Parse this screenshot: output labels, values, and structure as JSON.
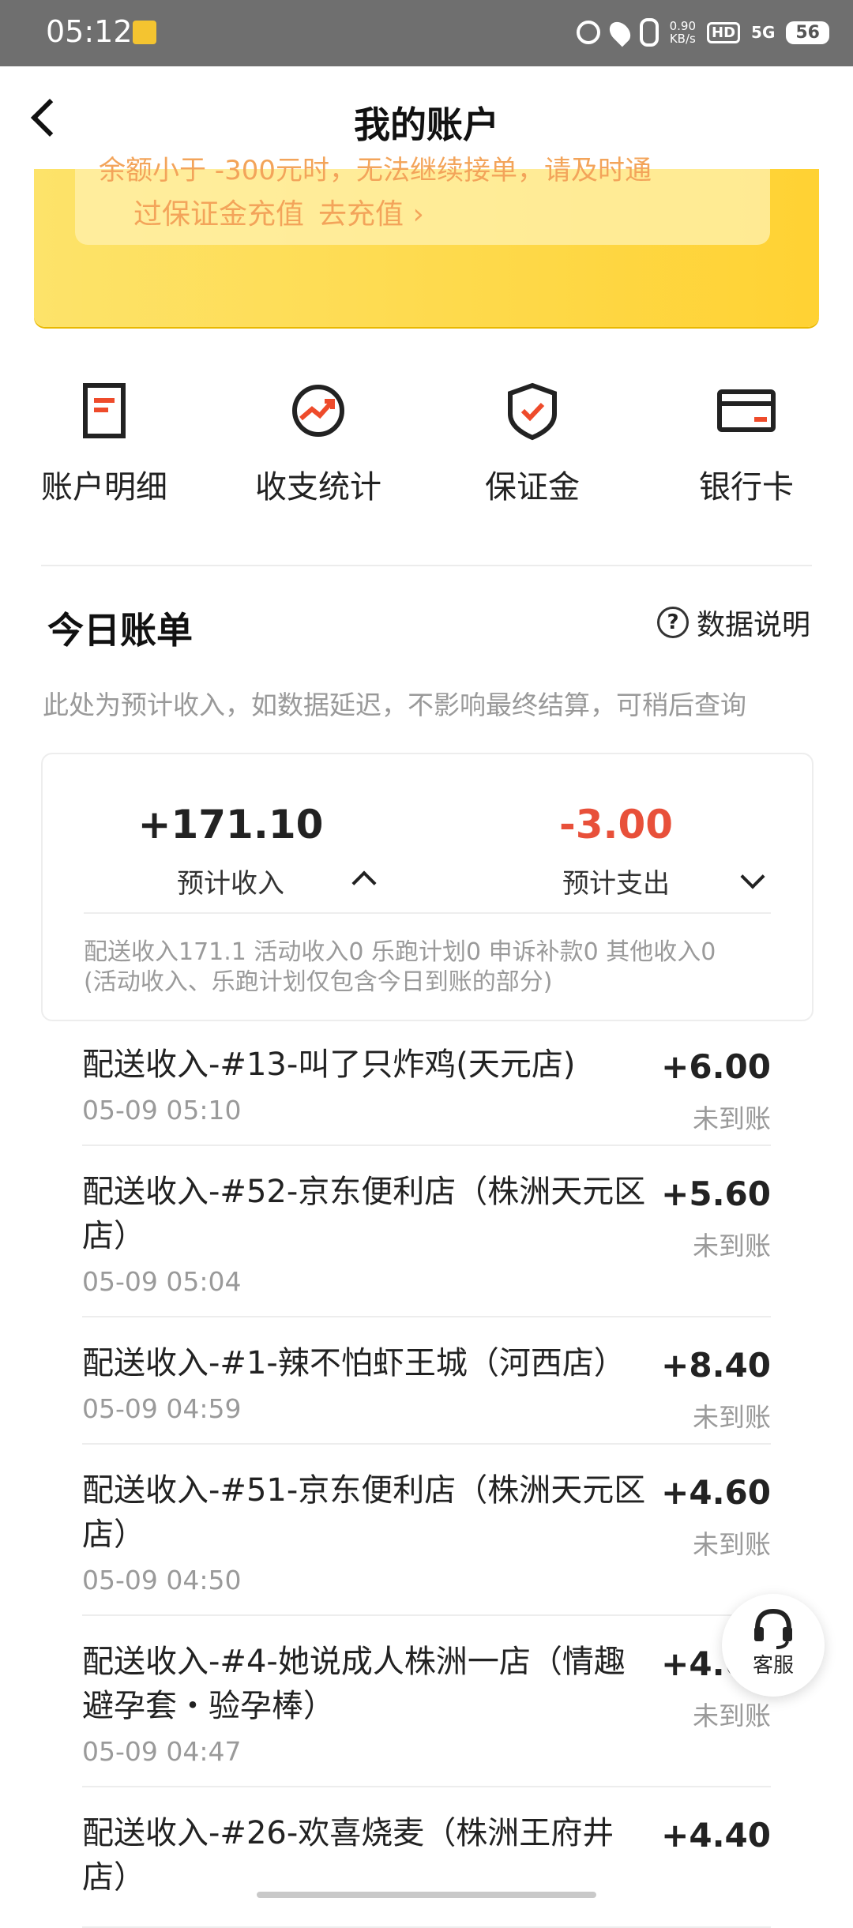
{
  "status_bar": {
    "time": "05:12",
    "speed": "0.90",
    "speed_unit": "KB/s",
    "hd": "HD",
    "network": "5G",
    "battery": "56"
  },
  "header": {
    "title": "我的账户"
  },
  "banner": {
    "notice_top": "余额小于 -300元时，无法继续接单，请及时通",
    "notice_main": "过保证金充值",
    "notice_link": "去充值 ›"
  },
  "shortcuts": [
    {
      "label": "账户明细",
      "icon": "document-icon"
    },
    {
      "label": "收支统计",
      "icon": "trend-icon"
    },
    {
      "label": "保证金",
      "icon": "shield-check-icon"
    },
    {
      "label": "银行卡",
      "icon": "bank-card-icon"
    }
  ],
  "bill": {
    "title": "今日账单",
    "explain": "数据说明",
    "note": "此处为预计收入，如数据延迟，不影响最终结算，可稍后查询",
    "income_value": "+171.10",
    "income_label": "预计收入",
    "expense_value": "-3.00",
    "expense_label": "预计支出",
    "detail_line1": "配送收入171.1 活动收入0 乐跑计划0 申诉补款0 其他收入0",
    "detail_line2": "(活动收入、乐跑计划仅包含今日到账的部分)"
  },
  "records": [
    {
      "title": "配送收入-#13-叫了只炸鸡(天元店)",
      "time": "05-09 05:10",
      "amount": "+6.00",
      "status": "未到账"
    },
    {
      "title": "配送收入-#52-京东便利店（株洲天元区店）",
      "time": "05-09 05:04",
      "amount": "+5.60",
      "status": "未到账"
    },
    {
      "title": "配送收入-#1-辣不怕虾王城（河西店）",
      "time": "05-09 04:59",
      "amount": "+8.40",
      "status": "未到账"
    },
    {
      "title": "配送收入-#51-京东便利店（株洲天元区店）",
      "time": "05-09 04:50",
      "amount": "+4.60",
      "status": "未到账"
    },
    {
      "title": "配送收入-#4-她说成人株洲一店（情趣避孕套・验孕棒）",
      "time": "05-09 04:47",
      "amount": "+4.60",
      "status": "未到账"
    },
    {
      "title": "配送收入-#26-欢喜烧麦（株洲王府井店）",
      "time": "",
      "amount": "+4.40",
      "status": ""
    }
  ],
  "customer_service": {
    "label": "客服"
  },
  "colors": {
    "accent_yellow": "#ffd233",
    "expense_red": "#e8503a",
    "icon_red": "#ee4b2b"
  }
}
